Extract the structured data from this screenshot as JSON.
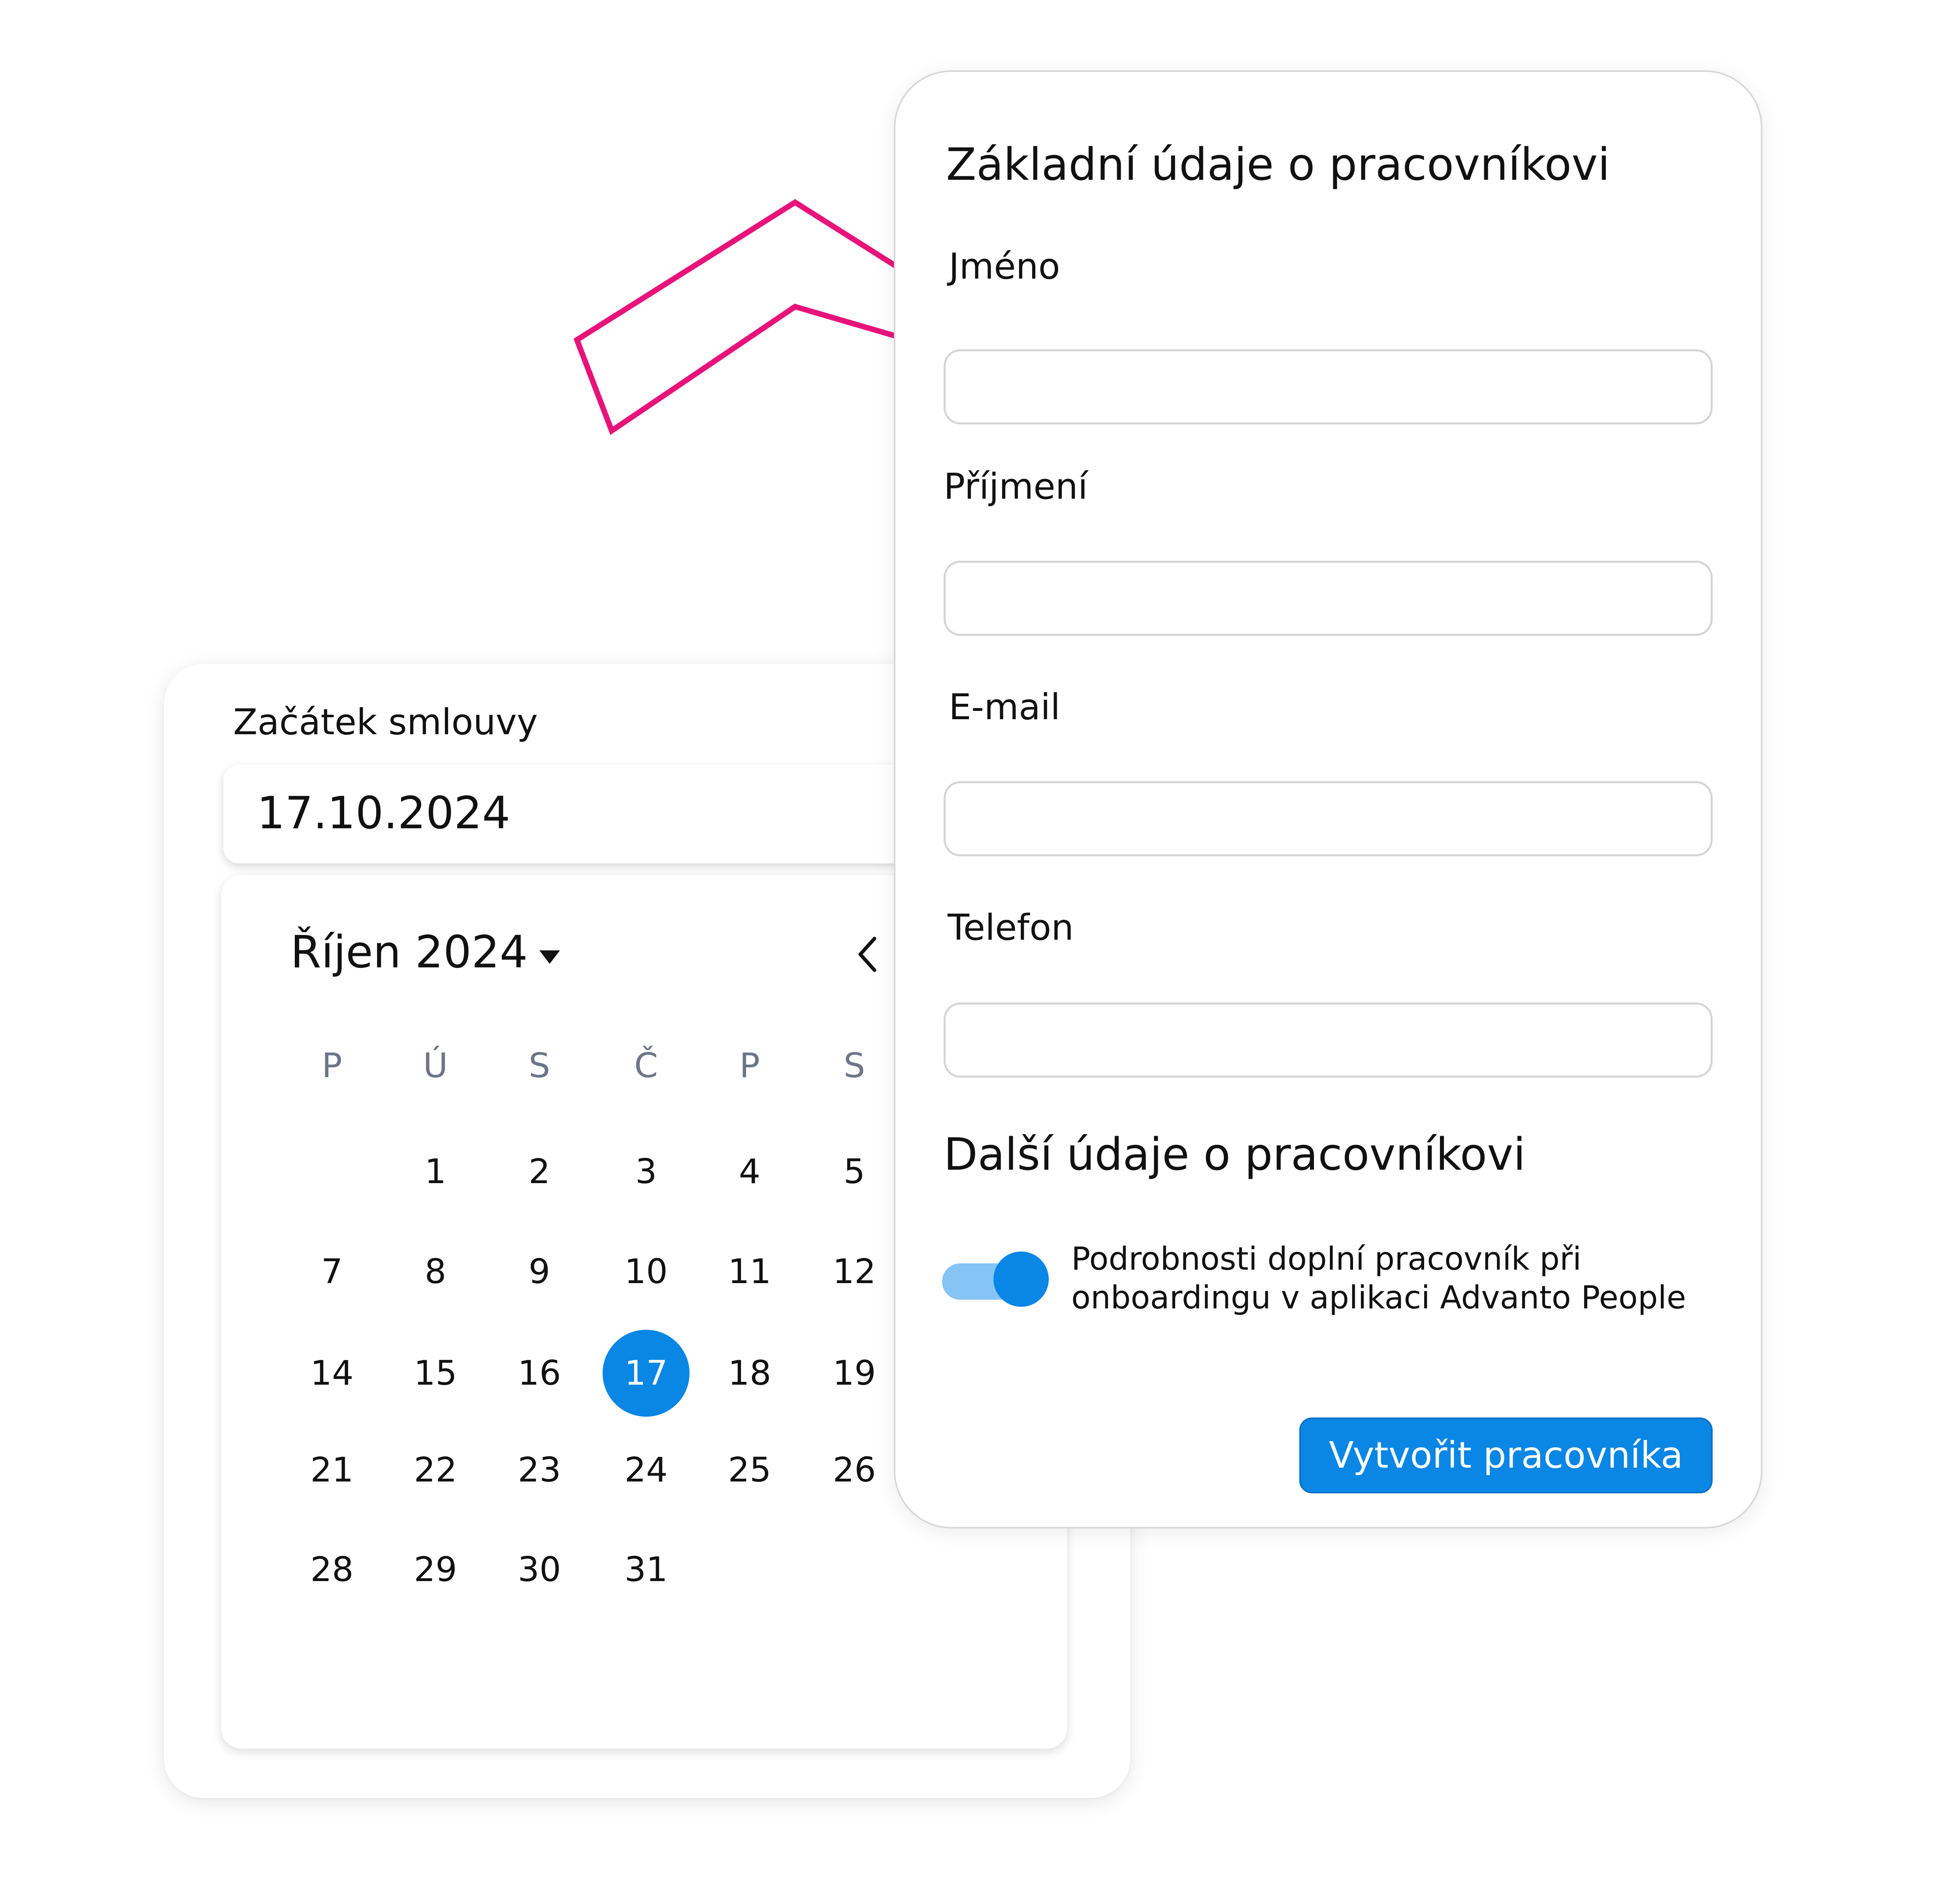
{
  "colors": {
    "accent": "#0a86e5",
    "accent_light": "#85c4f5",
    "decor": "#e8137a",
    "weekday_text": "#6d7688"
  },
  "contract": {
    "label": "Začátek smlouvy",
    "value": "17.10.2024"
  },
  "calendar": {
    "month_label": "Říjen 2024",
    "weekdays": [
      "P",
      "Ú",
      "S",
      "Č",
      "P",
      "S"
    ],
    "weeks": [
      [
        "",
        "1",
        "2",
        "3",
        "4",
        "5"
      ],
      [
        "7",
        "8",
        "9",
        "10",
        "11",
        "12"
      ],
      [
        "14",
        "15",
        "16",
        "17",
        "18",
        "19"
      ],
      [
        "21",
        "22",
        "23",
        "24",
        "25",
        "26"
      ],
      [
        "28",
        "29",
        "30",
        "31",
        "",
        ""
      ]
    ],
    "selected_day": "17"
  },
  "form": {
    "title": "Základní údaje o pracovníkovi",
    "fields": [
      {
        "label": "Jméno",
        "value": ""
      },
      {
        "label": "Příjmení",
        "value": ""
      },
      {
        "label": "E-mail",
        "value": ""
      },
      {
        "label": "Telefon",
        "value": ""
      }
    ],
    "section_title": "Další údaje o pracovníkovi",
    "toggle": {
      "on": true,
      "text_line1": "Podrobnosti doplní pracovník při",
      "text_line2": "onboardingu v aplikaci Advanto People"
    },
    "submit_label": "Vytvořit pracovníka"
  }
}
